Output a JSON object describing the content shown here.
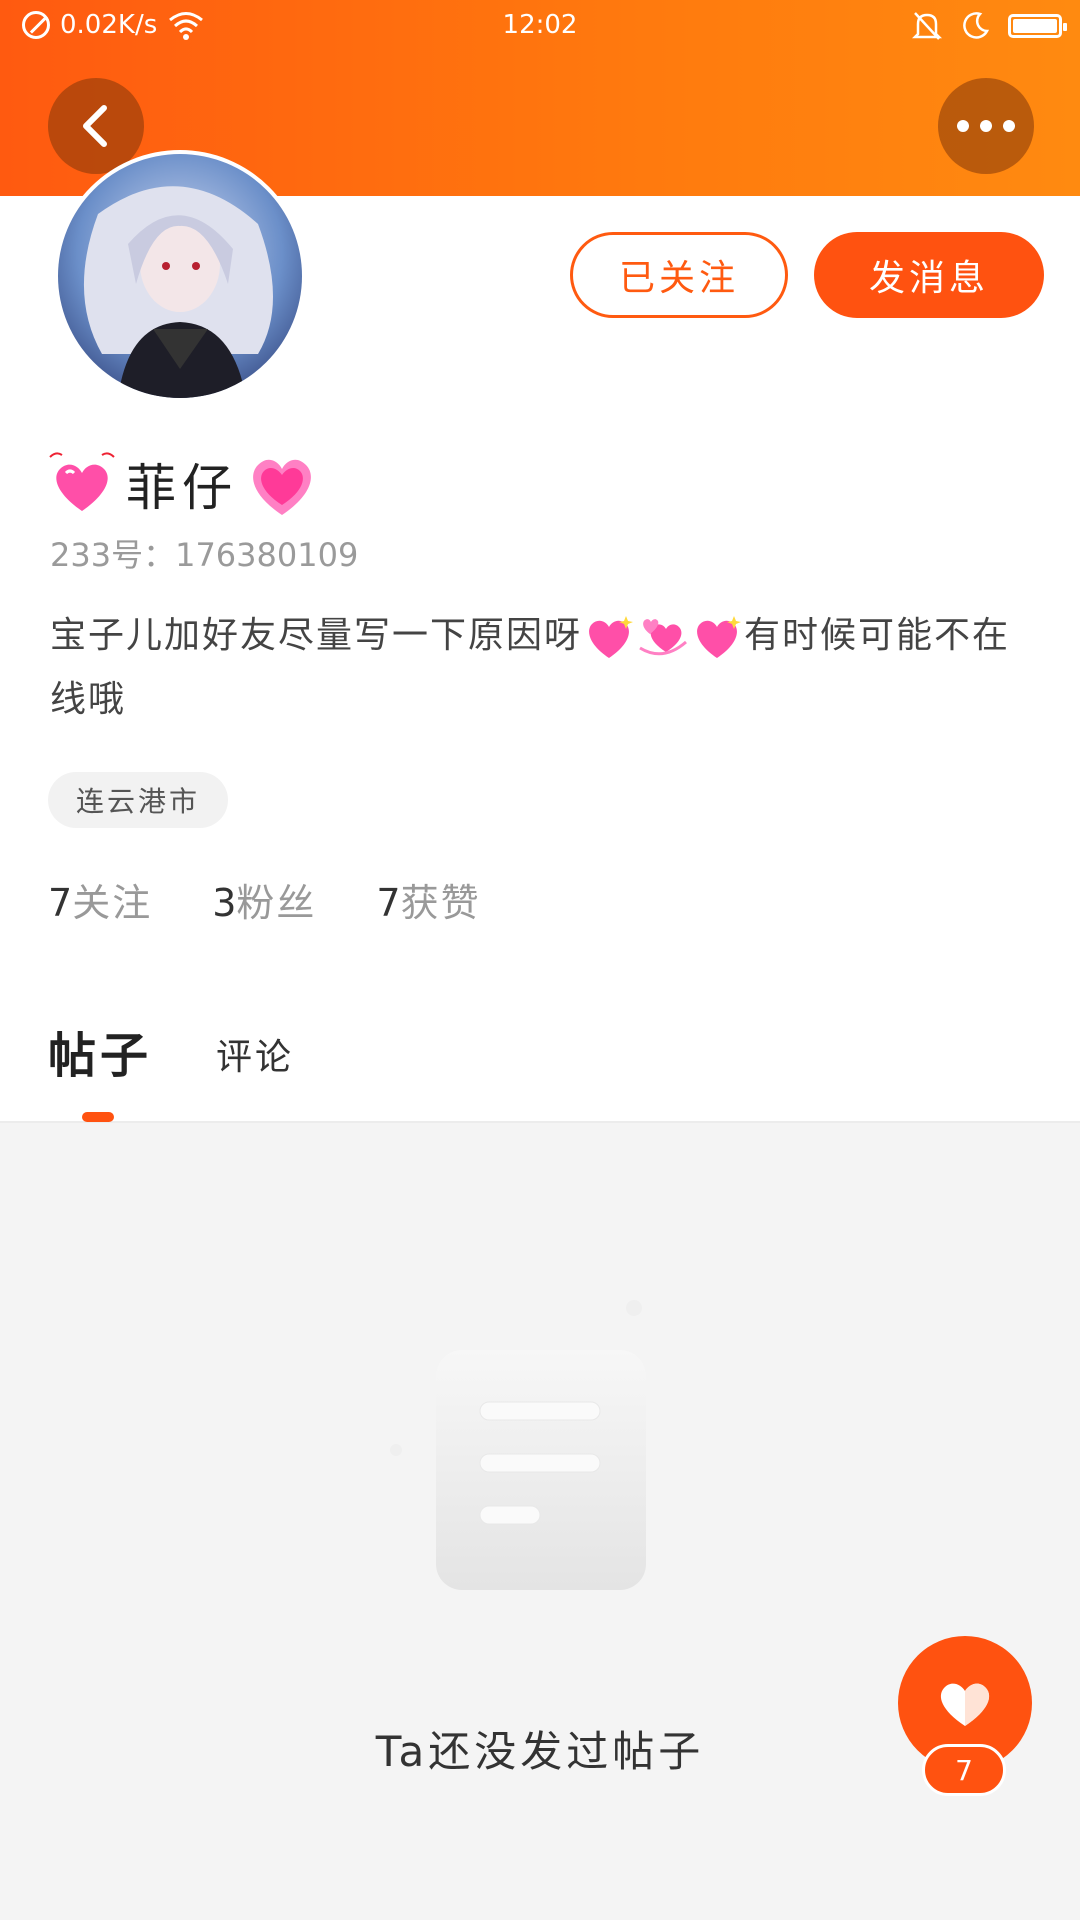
{
  "status_bar": {
    "net_speed": "0.02K/s",
    "time": "12:02",
    "icons": [
      "no-sim-icon",
      "wifi-icon",
      "mute-bell-icon",
      "moon-icon",
      "battery-icon"
    ]
  },
  "header": {
    "back_icon": "chevron-left-icon",
    "more_icon": "more-dots-icon",
    "gradient_colors": [
      "#ff5a10",
      "#ff8a10"
    ]
  },
  "profile": {
    "name": "菲仔",
    "uid": "233号：176380109",
    "bio_part1": "宝子儿加好友尽量写一下原因呀",
    "bio_part2": "有时候可能不在线哦",
    "location_tag": "连云港市",
    "follow_button": "已关注",
    "message_button": "发消息",
    "stats": [
      {
        "num": "7",
        "label": "关注"
      },
      {
        "num": "3",
        "label": "粉丝"
      },
      {
        "num": "7",
        "label": "获赞"
      }
    ]
  },
  "tabs": [
    {
      "label": "帖子",
      "active": true
    },
    {
      "label": "评论",
      "active": false
    }
  ],
  "empty_state": {
    "message": "Ta还没发过帖子"
  },
  "like_fab": {
    "count": "7"
  },
  "colors": {
    "accent": "#ff5210",
    "page_bg": "#f4f4f4"
  }
}
